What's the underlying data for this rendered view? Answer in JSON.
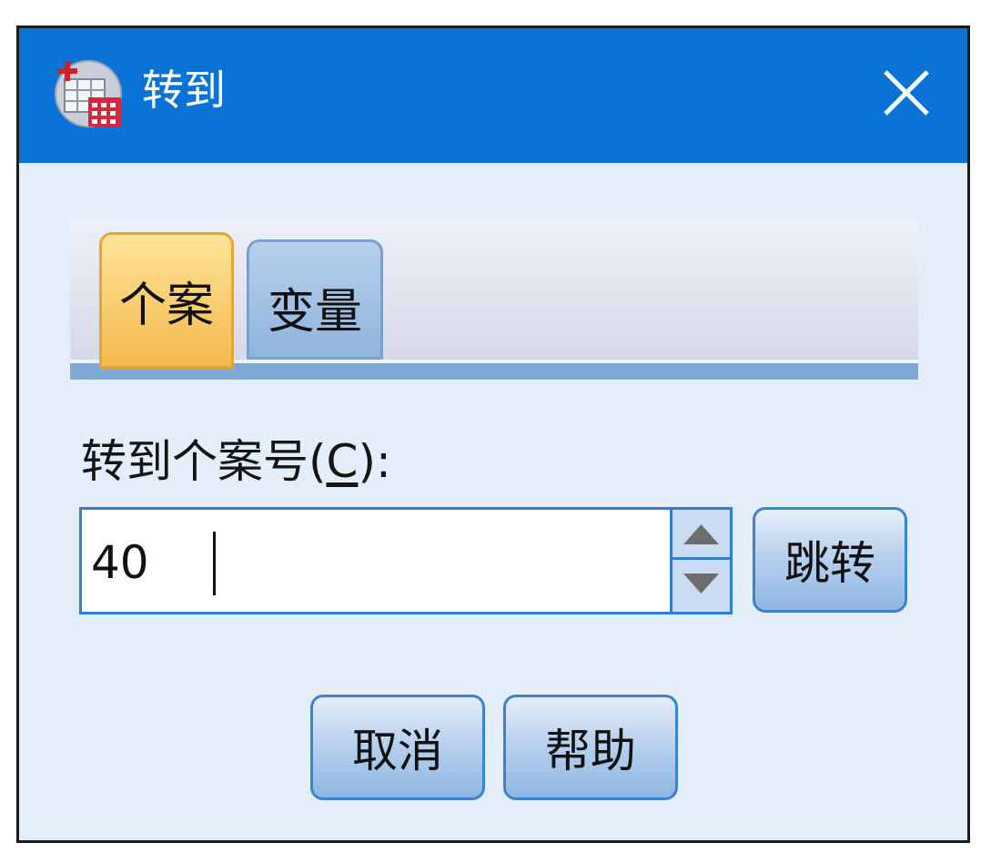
{
  "dialog": {
    "title": "转到",
    "app_icon": "spss-data-editor-icon",
    "close_icon": "close-icon"
  },
  "tabs": [
    {
      "label": "个案",
      "active": true
    },
    {
      "label": "变量",
      "active": false
    }
  ],
  "field": {
    "label_prefix": "转到个案号(",
    "label_mnemonic": "C",
    "label_suffix": "):",
    "value": "40"
  },
  "buttons": {
    "jump": "跳转",
    "cancel": "取消",
    "help": "帮助"
  },
  "colors": {
    "titlebar": "#0a74d6",
    "dialog_bg": "#e3eefa",
    "active_tab": "#f6b94c",
    "accent_border": "#3b82d0"
  }
}
